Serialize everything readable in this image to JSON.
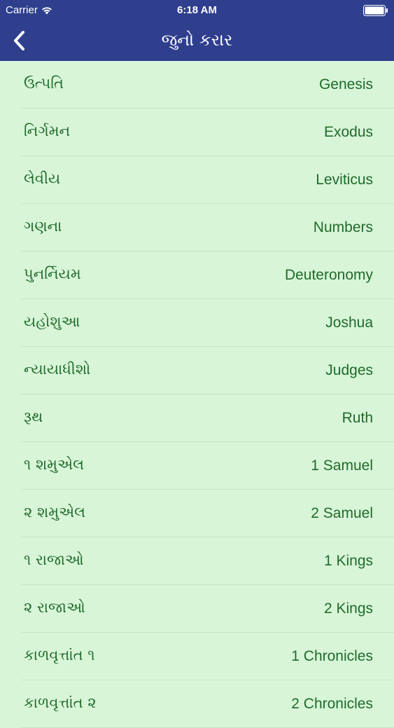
{
  "status_bar": {
    "carrier": "Carrier",
    "time": "6:18 AM"
  },
  "nav": {
    "title": "જુનો કરાર",
    "back_icon": "chevron-left-icon"
  },
  "colors": {
    "nav_background": "#2f3f8e",
    "list_background": "#d8f5d8",
    "row_text": "#1f6b2a"
  },
  "books": [
    {
      "gu": "ઉત્પતિ",
      "en": "Genesis"
    },
    {
      "gu": "નિર્ગમન",
      "en": "Exodus"
    },
    {
      "gu": "લેવીય",
      "en": "Leviticus"
    },
    {
      "gu": "ગણના",
      "en": "Numbers"
    },
    {
      "gu": "પુનર્નિયમ",
      "en": "Deuteronomy"
    },
    {
      "gu": "યહોશુઆ",
      "en": "Joshua"
    },
    {
      "gu": "ન્યાયાધીશો",
      "en": "Judges"
    },
    {
      "gu": "રૂથ",
      "en": "Ruth"
    },
    {
      "gu": "૧ શમુએલ",
      "en": "1 Samuel"
    },
    {
      "gu": "૨ શમુએલ",
      "en": "2 Samuel"
    },
    {
      "gu": "૧ રાજાઓ",
      "en": "1 Kings"
    },
    {
      "gu": "૨ રાજાઓ",
      "en": "2 Kings"
    },
    {
      "gu": "કાળવૃત્તાંત ૧",
      "en": "1 Chronicles"
    },
    {
      "gu": "કાળવૃત્તાંત ૨",
      "en": "2 Chronicles"
    }
  ]
}
